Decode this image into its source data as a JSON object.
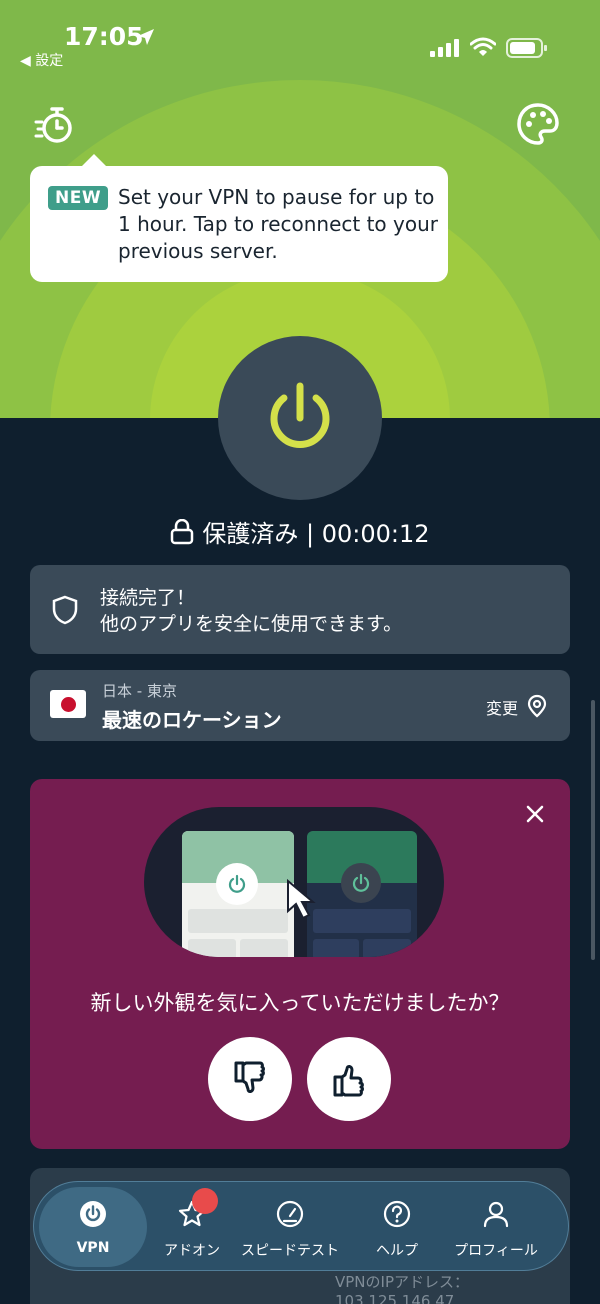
{
  "status_bar": {
    "time": "17:05",
    "back_label": "◀ 設定"
  },
  "tooltip": {
    "badge": "NEW",
    "text": "Set your VPN to pause for up to 1 hour. Tap to reconnect to your previous server."
  },
  "connection": {
    "status": "保護済み | 00:00:12",
    "title": "接続完了！",
    "subtitle": "他のアプリを安全に使用できます。"
  },
  "location": {
    "region": "日本 - 東京",
    "name": "最速のロケーション",
    "change_label": "変更"
  },
  "feedback": {
    "question": "新しい外観を気に入っていただけましたか？"
  },
  "map_card": {
    "ip_label": "VPNのIPアドレス：",
    "ip_value": "103.125.146.47"
  },
  "tabs": [
    {
      "label": "VPN",
      "icon": "power-icon",
      "active": true
    },
    {
      "label": "アドオン",
      "icon": "star-icon",
      "badge": true
    },
    {
      "label": "スピードテスト",
      "icon": "speedometer-icon"
    },
    {
      "label": "ヘルプ",
      "icon": "help-icon"
    },
    {
      "label": "プロフィール",
      "icon": "person-icon"
    }
  ],
  "colors": {
    "accent_green": "#d4e04a",
    "background": "#0f1f2e",
    "card": "#3a4a58",
    "feedback_bg": "#751d50",
    "badge_teal": "#3f9e8a"
  }
}
